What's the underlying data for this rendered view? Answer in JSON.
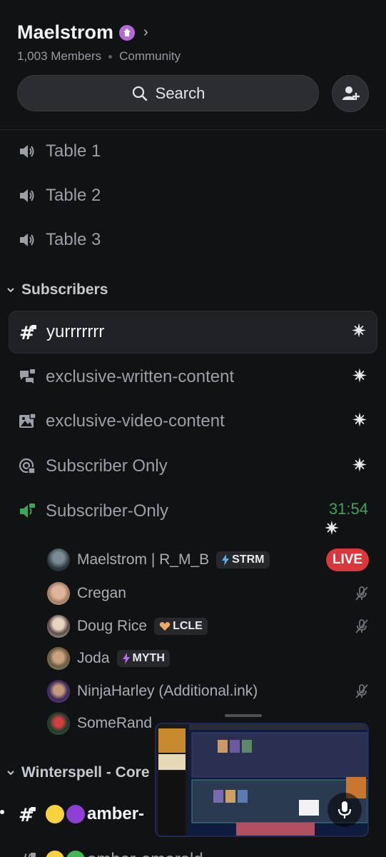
{
  "server": {
    "name": "Maelstrom",
    "members": "1,003 Members",
    "type": "Community",
    "search_label": "Search"
  },
  "voice_channels": [
    {
      "label": "Table 1"
    },
    {
      "label": "Table 2"
    },
    {
      "label": "Table 3"
    }
  ],
  "categories": {
    "subscribers": "Subscribers",
    "winterspell": "Winterspell - Core"
  },
  "subscriber_channels": [
    {
      "label": "yurrrrrrr"
    },
    {
      "label": "exclusive-written-content"
    },
    {
      "label": "exclusive-video-content"
    },
    {
      "label": "Subscriber Only"
    },
    {
      "label": "Subscriber-Only"
    }
  ],
  "voice_session": {
    "duration": "31:54",
    "live_label": "LIVE"
  },
  "members": [
    {
      "name": "Maelstrom | R_M_B",
      "tag": "STRM"
    },
    {
      "name": "Cregan"
    },
    {
      "name": "Doug Rice",
      "tag": "LCLE"
    },
    {
      "name": "Joda",
      "tag": "MYTH"
    },
    {
      "name": "NinjaHarley (Additional.ink)"
    },
    {
      "name": "SomeRand"
    }
  ],
  "winterspell_channels": [
    {
      "label": "amber-"
    },
    {
      "label": "amber-emerald"
    }
  ],
  "colors": {
    "background": "#111214",
    "accent_green": "#3ba55c",
    "live_red": "#da373c",
    "boost_purple": "#b469d6"
  }
}
